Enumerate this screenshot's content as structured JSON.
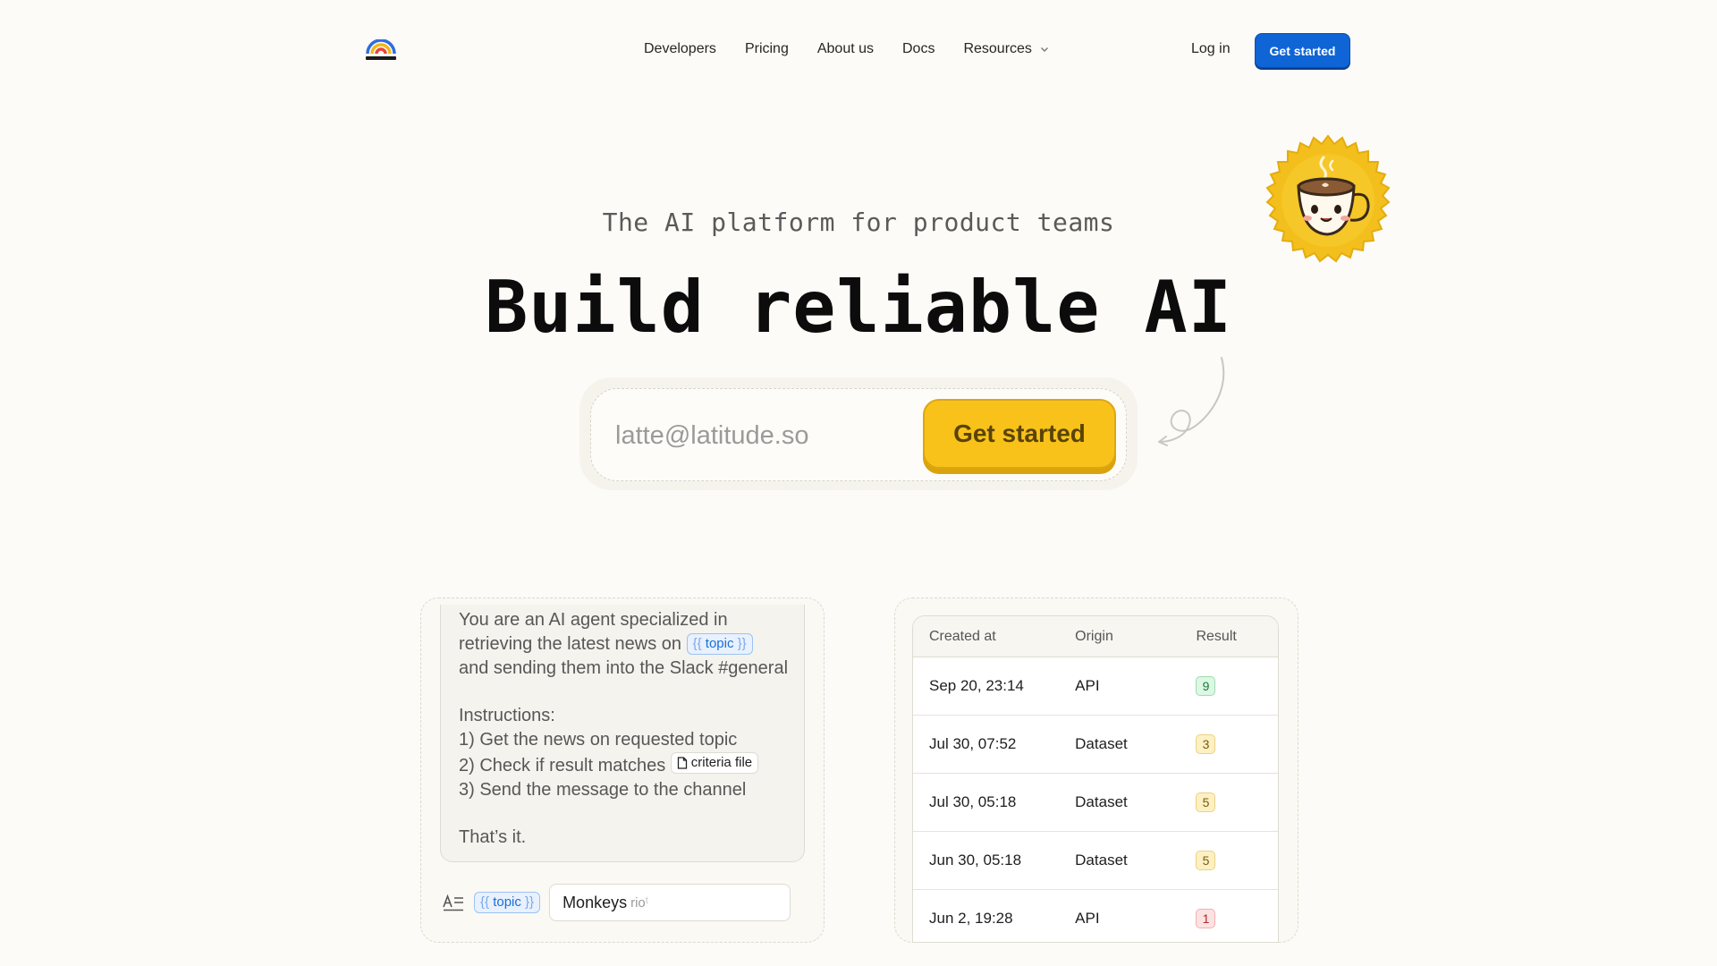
{
  "nav": {
    "links": [
      "Developers",
      "Pricing",
      "About us",
      "Docs",
      "Resources"
    ],
    "login": "Log in",
    "cta": "Get started"
  },
  "hero": {
    "eyebrow": "The AI platform for product teams",
    "headline": "Build reliable AI",
    "email_placeholder": "latte@latitude.so",
    "cta": "Get started"
  },
  "prompt_card": {
    "line1": "You are an AI agent specialized in",
    "line2_pre": "retrieving the latest news on",
    "variable": "topic",
    "line3": "and sending them into the Slack #general",
    "instructions_heading": "Instructions:",
    "step1": "1) Get the news on requested topic",
    "step2_pre": "2) Check if result matches",
    "file_chip": "criteria file",
    "step3": "3) Send the message to the channel",
    "closing": "That’s it.",
    "param_variable": "topic",
    "param_value": "Monkeys",
    "param_typing": "rio",
    "param_typing_ghost": "t"
  },
  "logs_table": {
    "headers": [
      "Created at",
      "Origin",
      "Result"
    ],
    "rows": [
      {
        "created": "Sep 20, 23:14",
        "origin": "API",
        "result": "9",
        "status": "green"
      },
      {
        "created": "Jul 30, 07:52",
        "origin": "Dataset",
        "result": "3",
        "status": "yellow"
      },
      {
        "created": "Jul 30, 05:18",
        "origin": "Dataset",
        "result": "5",
        "status": "yellow"
      },
      {
        "created": "Jun 30, 05:18",
        "origin": "Dataset",
        "result": "5",
        "status": "yellow"
      },
      {
        "created": "Jun 2, 19:28",
        "origin": "API",
        "result": "1",
        "status": "red"
      }
    ]
  },
  "colors": {
    "background": "#fcfbf7",
    "primary_blue": "#0f65d6",
    "accent_yellow": "#f8c21a"
  },
  "icons": [
    "latitude-logo-icon",
    "chevron-down-icon",
    "coffee-mug-badge-icon",
    "curly-arrow-icon",
    "file-icon",
    "text-params-icon"
  ]
}
